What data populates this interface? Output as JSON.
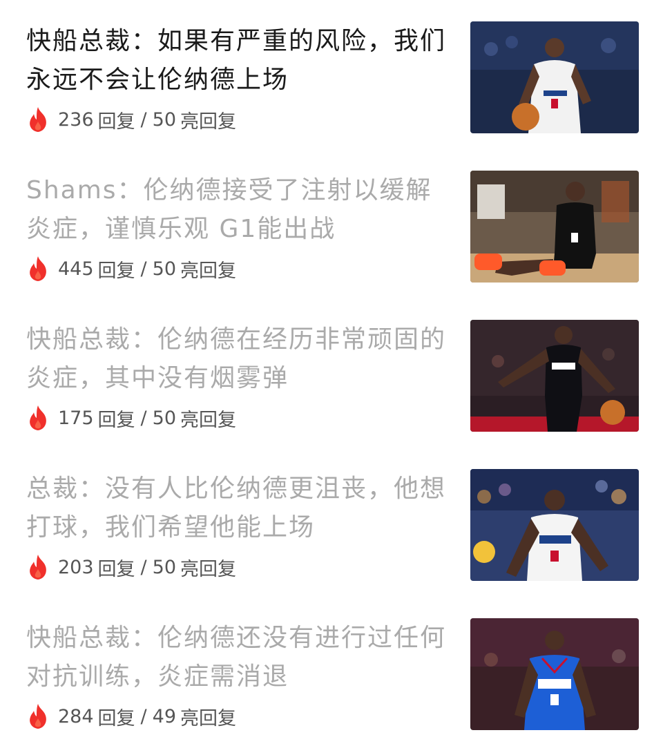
{
  "colors": {
    "title_unread": "#1a1a1a",
    "title_read": "#aaaaaa",
    "meta_text": "#555555",
    "fire_icon": "#f0302b"
  },
  "feed": {
    "items": [
      {
        "title": "快船总裁：如果有严重的风险，我们永远不会让伦纳德上场",
        "replies": "236",
        "replies_label": "回复",
        "separator": "/",
        "highlights": "50",
        "highlights_label": "亮回复",
        "read": false,
        "thumb_icon": "player-photo"
      },
      {
        "title": "Shams：伦纳德接受了注射以缓解炎症，谨慎乐观 G1能出战",
        "replies": "445",
        "replies_label": "回复",
        "separator": "/",
        "highlights": "50",
        "highlights_label": "亮回复",
        "read": true,
        "thumb_icon": "player-photo"
      },
      {
        "title": "快船总裁：伦纳德在经历非常顽固的炎症，其中没有烟雾弹",
        "replies": "175",
        "replies_label": "回复",
        "separator": "/",
        "highlights": "50",
        "highlights_label": "亮回复",
        "read": true,
        "thumb_icon": "player-photo"
      },
      {
        "title": "总裁：没有人比伦纳德更沮丧，他想打球，我们希望他能上场",
        "replies": "203",
        "replies_label": "回复",
        "separator": "/",
        "highlights": "50",
        "highlights_label": "亮回复",
        "read": true,
        "thumb_icon": "player-photo"
      },
      {
        "title": "快船总裁：伦纳德还没有进行过任何对抗训练，炎症需消退",
        "replies": "284",
        "replies_label": "回复",
        "separator": "/",
        "highlights": "49",
        "highlights_label": "亮回复",
        "read": true,
        "thumb_icon": "player-photo"
      }
    ]
  }
}
